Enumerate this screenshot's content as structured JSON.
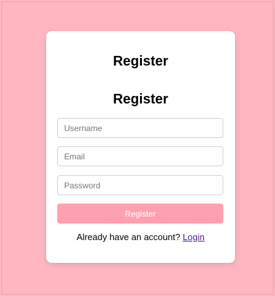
{
  "colors": {
    "page_background": "#ffb6c1",
    "card_background": "#ffffff",
    "button_background": "#ffa0b0",
    "button_text": "#ffffff",
    "link": "#551a8b"
  },
  "card": {
    "heading": "Register",
    "form_heading": "Register",
    "username": {
      "placeholder": "Username",
      "value": ""
    },
    "email": {
      "placeholder": "Email",
      "value": ""
    },
    "password": {
      "placeholder": "Password",
      "value": ""
    },
    "submit_label": "Register",
    "footer": {
      "prompt": "Already have an account?",
      "link_label": "Login"
    }
  }
}
